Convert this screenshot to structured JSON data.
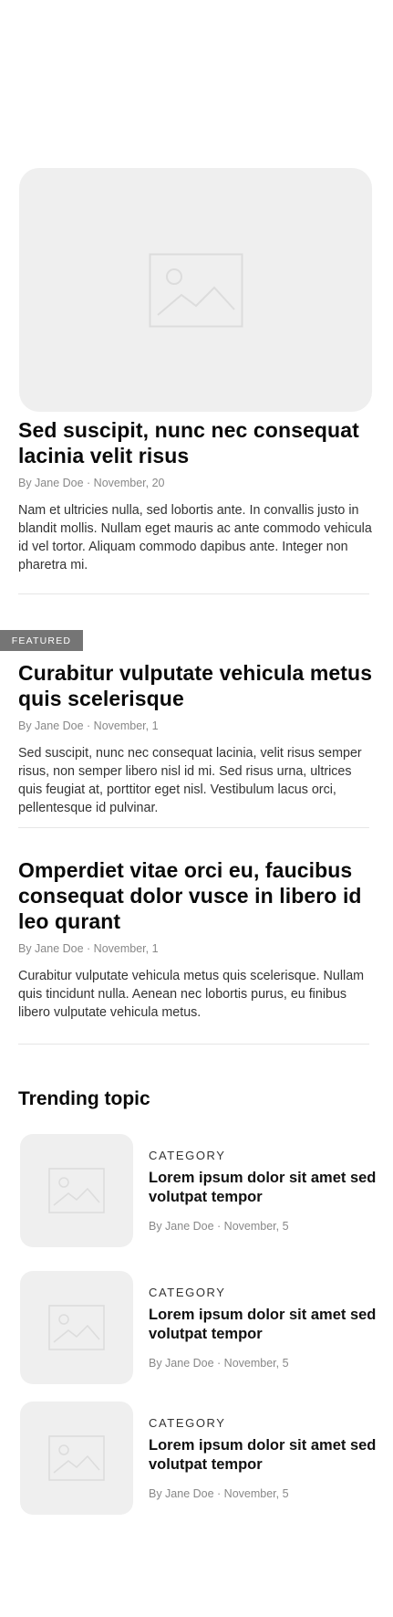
{
  "hero": {
    "image_icon": "image-placeholder-icon"
  },
  "articles": [
    {
      "title": "Sed suscipit, nunc nec consequat lacinia velit risus",
      "meta": "By Jane Doe · November, 20",
      "excerpt": "Nam et ultricies nulla, sed lobortis ante. In convallis justo in blandit mollis. Nullam eget mauris ac ante commodo vehicula id vel tortor. Aliquam commodo dapibus ante. Integer non pharetra mi."
    },
    {
      "badge": "FEATURED",
      "title": "Curabitur vulputate vehicula metus quis scelerisque",
      "meta": "By Jane Doe · November, 1",
      "excerpt": "Sed suscipit, nunc nec consequat lacinia, velit risus semper risus, non semper libero nisl id mi. Sed risus urna, ultrices quis feugiat at, porttitor eget nisl. Vestibulum lacus orci, pellentesque id pulvinar."
    },
    {
      "title": "Omperdiet vitae orci eu, faucibus consequat dolor vusce in libero id leo qurant",
      "meta": "By Jane Doe · November, 1",
      "excerpt": "Curabitur vulputate vehicula metus quis scelerisque. Nullam quis tincidunt nulla. Aenean nec lobortis purus, eu finibus libero vulputate vehicula metus."
    }
  ],
  "trending": {
    "heading": "Trending topic",
    "items": [
      {
        "category": "CATEGORY",
        "title": "Lorem ipsum dolor sit amet sed volutpat tempor",
        "meta": "By Jane Doe · November, 5"
      },
      {
        "category": "CATEGORY",
        "title": "Lorem ipsum dolor sit amet sed volutpat tempor",
        "meta": "By Jane Doe · November, 5"
      },
      {
        "category": "CATEGORY",
        "title": "Lorem ipsum dolor sit amet sed volutpat tempor",
        "meta": "By Jane Doe · November, 5"
      }
    ]
  },
  "colors": {
    "placeholder_bg": "#efefef",
    "placeholder_stroke": "#dedede",
    "badge_bg": "#757575"
  }
}
